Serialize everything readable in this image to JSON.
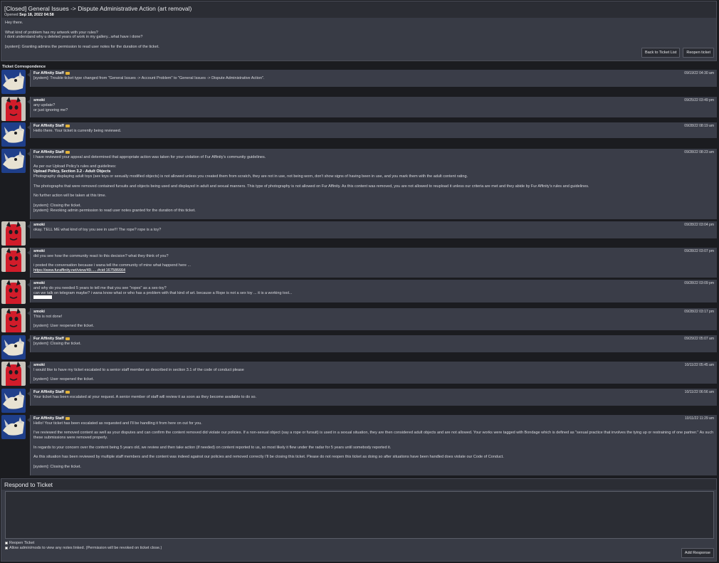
{
  "ticket": {
    "title": "[Closed] General Issues -> Dispute Administrative Action (art removal)",
    "opened_label": "Opened",
    "opened_date": "Sep 18, 2022 04:58",
    "body": [
      "Hey there.",
      "",
      "What kind of problem has my artwork with your rules?",
      "i dont understand why u deleted years of work in my gallery...what have i done?",
      "",
      "[system]: Granting admins the permission to read user notes for the duration of the ticket."
    ],
    "back_label": "Back to Ticket List",
    "reopen_label": "Reopen ticket"
  },
  "section_label": "Ticket Correspondence",
  "messages": [
    {
      "author": "Fur Affinity Staff",
      "staff": true,
      "time": "09/19/22 04:30 am",
      "lines": [
        "[system]: Trouble ticket type changed from \"General Issues -> Account Problem\" to \"General Issues -> Dispute Administrative Action\"."
      ]
    },
    {
      "author": "smoki",
      "staff": false,
      "time": "09/25/22 03:49 pm",
      "lines": [
        "any update?",
        "or just ignoring me?"
      ]
    },
    {
      "author": "Fur Affinity Staff",
      "staff": true,
      "time": "09/28/22 08:19 am",
      "lines": [
        "Hello there. Your ticket is currently being reviewed."
      ]
    },
    {
      "author": "Fur Affinity Staff",
      "staff": true,
      "time": "09/28/22 08:23 am",
      "lines": [
        "I have reviewed your appeal and determined that appropriate action was taken for your violation of Fur Affinity's community guidelines.",
        "",
        "As per our Upload Policy's rules and guidelines:",
        "Upload Policy, Section 3.2 - Adult Objects",
        "Photography displaying adult toys (sex toys or sexually modified objects) is not allowed unless you created them from scratch, they are not in use, not being worn, don't show signs of having been in use, and you mark them with the adult content rating.",
        "",
        "The photographs that were removed contained fursuits and objects being used and displayed in adult and sexual manners. This type of photography is not allowed on Fur Affinity. As this content was removed, you are not allowed to reupload it unless our criteria are met and they abide by Fur Affinity's rules and guidelines.",
        "",
        "No further action will be taken at this time.",
        "",
        "[system]: Closing the ticket.",
        "[system]: Revoking admin permission to read user notes granted for the duration of this ticket."
      ]
    },
    {
      "author": "smoki",
      "staff": false,
      "time": "09/28/22 03:04 pm",
      "lines": [
        "okay. TELL ME what kind of toy you see in use!!! The rope? rope is a toy?"
      ]
    },
    {
      "author": "smoki",
      "staff": false,
      "time": "09/28/22 03:07 pm",
      "lines": [
        "did you see how the community react to this decision? what they think of you?",
        "",
        "i posted the conversation because i wana tell the community of mine what happend here ...",
        "https://www.furaffinity.net/view/49......#cid:167586664"
      ]
    },
    {
      "author": "smoki",
      "staff": false,
      "time": "09/28/22 03:09 pm",
      "lines": [
        "and why do you needed 5 years to tell me that you see \"ropes\" as a sex-toy?",
        "can we talk on telegram maybe? i wana know what or who has a problem with that kind of art. because a Rope is not a sex toy ... it is a working tool..."
      ]
    },
    {
      "author": "smoki",
      "staff": false,
      "time": "09/28/22 03:17 pm",
      "lines": [
        "This is not done!",
        "",
        "[system]: User reopened the ticket."
      ]
    },
    {
      "author": "Fur Affinity Staff",
      "staff": true,
      "time": "09/29/22 05:07 am",
      "lines": [
        "[system]: Closing the ticket."
      ]
    },
    {
      "author": "smoki",
      "staff": false,
      "time": "10/11/22 05:45 am",
      "lines": [
        "I would like to have my ticket escalated to a senior staff member as described in section 3.1 of the code of conduct please",
        "",
        "[system]: User reopened the ticket."
      ]
    },
    {
      "author": "Fur Affinity Staff",
      "staff": true,
      "time": "10/11/22 06:56 am",
      "lines": [
        "Your ticket has been escalated at your request. A senior member of staff will review it as soon as they become available to do so."
      ]
    },
    {
      "author": "Fur Affinity Staff",
      "staff": true,
      "time": "10/11/22 11:29 am",
      "lines": [
        "Hello! Your ticket has been escalated as requested and I'll be handling it from here on out for you.",
        "",
        "I've reviewed the removed content as well as your disputes and can confirm the content removed did violate our policies. If a non-sexual object (say a rope or fursuit) is used in a sexual situation, they are then considered adult objects and are not allowed. Your works were tagged with Bondage which is defined as \"sexual practice that involves the tying up or restraining of one partner.\" As such these submissions were removed properly.",
        "",
        "In regards to your concern over the content being 5 years old, we review and then take action (if needed) on content reported to us, so most likely it flew under the radar for 5 years until somebody reported it.",
        "",
        "As this situation has been reviewed by multiple staff members and the content was indeed against our policies and removed correctly I'll be closing this ticket. Please do not reopen this ticket as doing so after situations have been handled does violate our Code of Conduct.",
        "",
        "[system]: Closing the ticket."
      ]
    }
  ],
  "respond": {
    "title": "Respond to Ticket",
    "reopen_label": "Reopen Ticket",
    "allow_label": "Allow admin/mods to view any notes linked. (Permission will be revoked on ticket close.)",
    "add_label": "Add Response"
  }
}
